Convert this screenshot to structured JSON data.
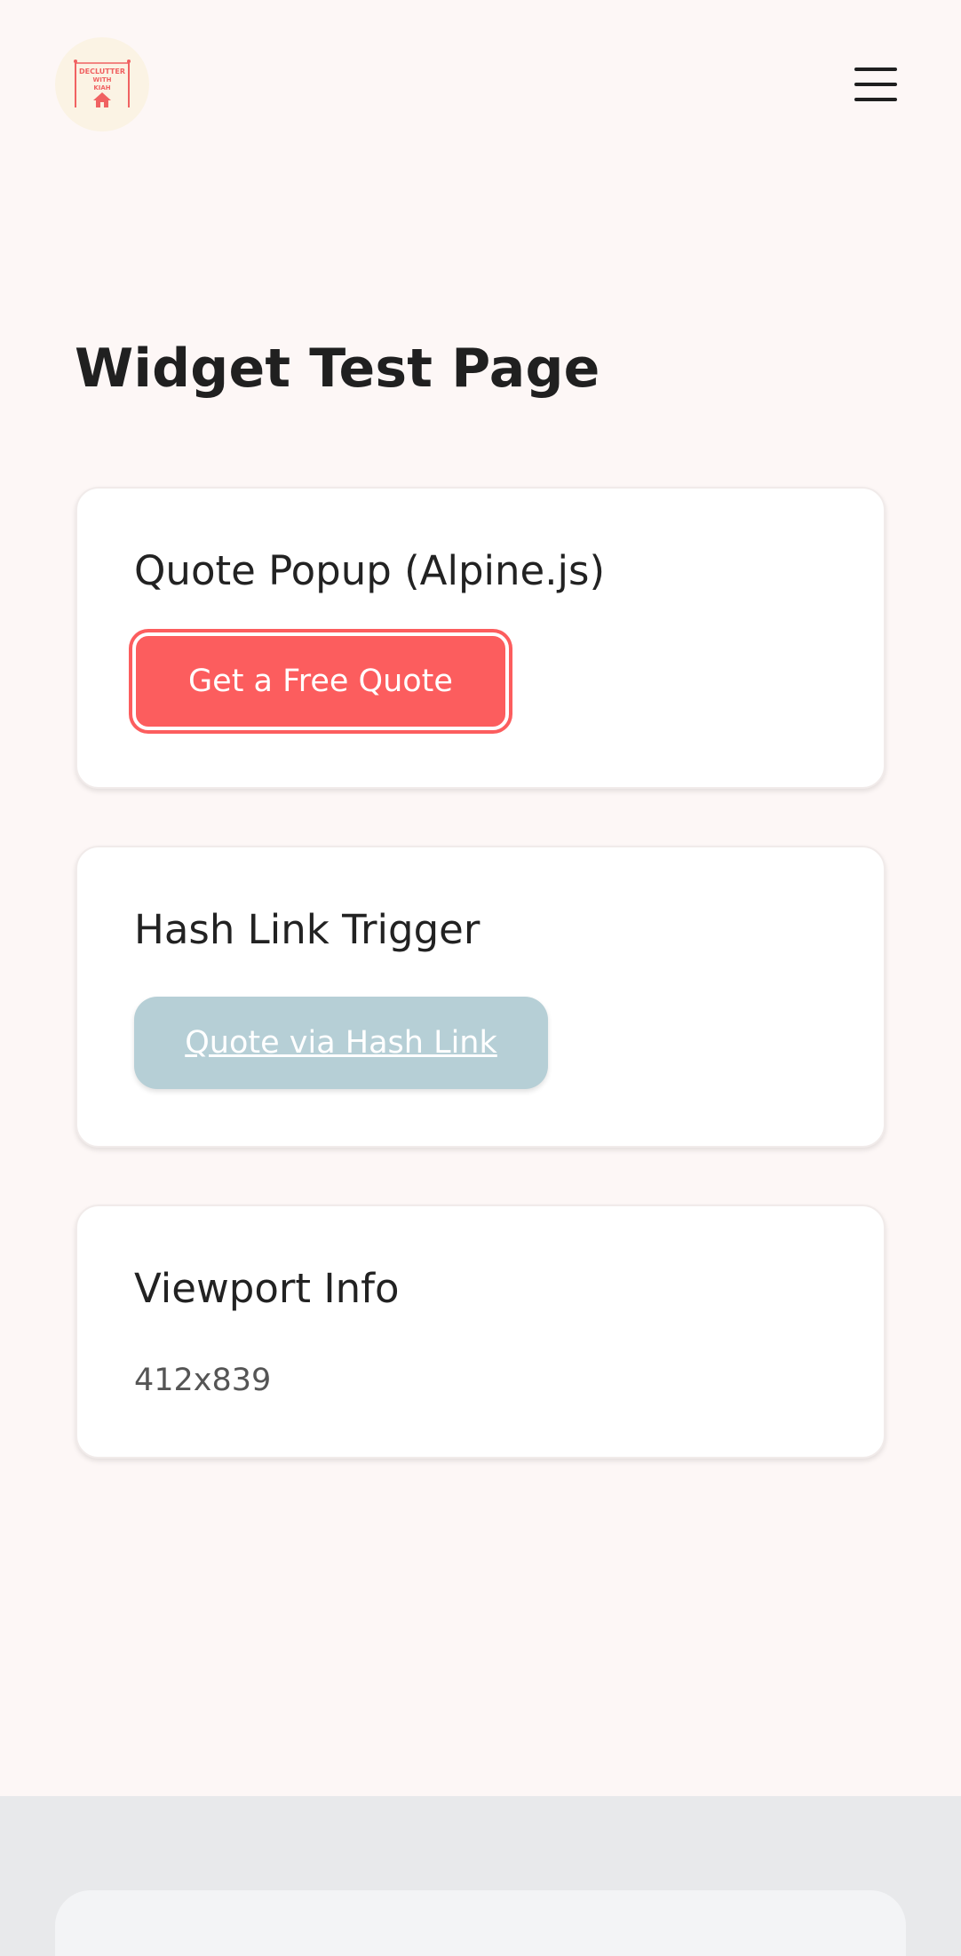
{
  "header": {
    "logo": {
      "line1": "DECLUTTER",
      "line2": "WITH",
      "line3": "KIAH",
      "icon": "house-icon",
      "accent_color": "#f06262"
    },
    "menu_icon": "hamburger-menu-icon"
  },
  "main": {
    "title": "Widget Test Page",
    "cards": [
      {
        "title": "Quote Popup (Alpine.js)",
        "button_label": "Get a Free Quote",
        "button_color": "#fc5d5e"
      },
      {
        "title": "Hash Link Trigger",
        "button_label": "Quote via Hash Link",
        "button_color": "#b6cfd6"
      },
      {
        "title": "Viewport Info",
        "value": "412x839"
      }
    ]
  }
}
